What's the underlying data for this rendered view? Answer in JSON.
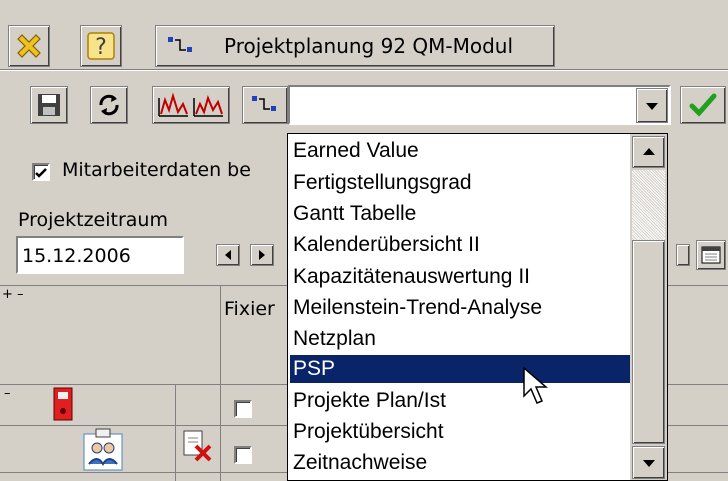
{
  "window": {
    "title": "Projektplanung 92 QM-Modul"
  },
  "toolbar": {
    "combo_value": ""
  },
  "options": {
    "employee_checkbox_label": "Mitarbeiterdaten be"
  },
  "period": {
    "label": "Projektzeitraum",
    "date": "15.12.2006"
  },
  "grid": {
    "expand_collapse": "+ –",
    "col_fixed": "Fixier",
    "row1_toggle": "–"
  },
  "dropdown": {
    "items": [
      "Earned Value",
      "Fertigstellungsgrad",
      "Gantt Tabelle",
      "Kalenderübersicht II",
      "Kapazitätenauswertung II",
      "Meilenstein-Trend-Analyse",
      "Netzplan",
      "PSP",
      "Projekte Plan/Ist",
      "Projektübersicht",
      "Zeitnachweise"
    ],
    "selected": "PSP"
  }
}
